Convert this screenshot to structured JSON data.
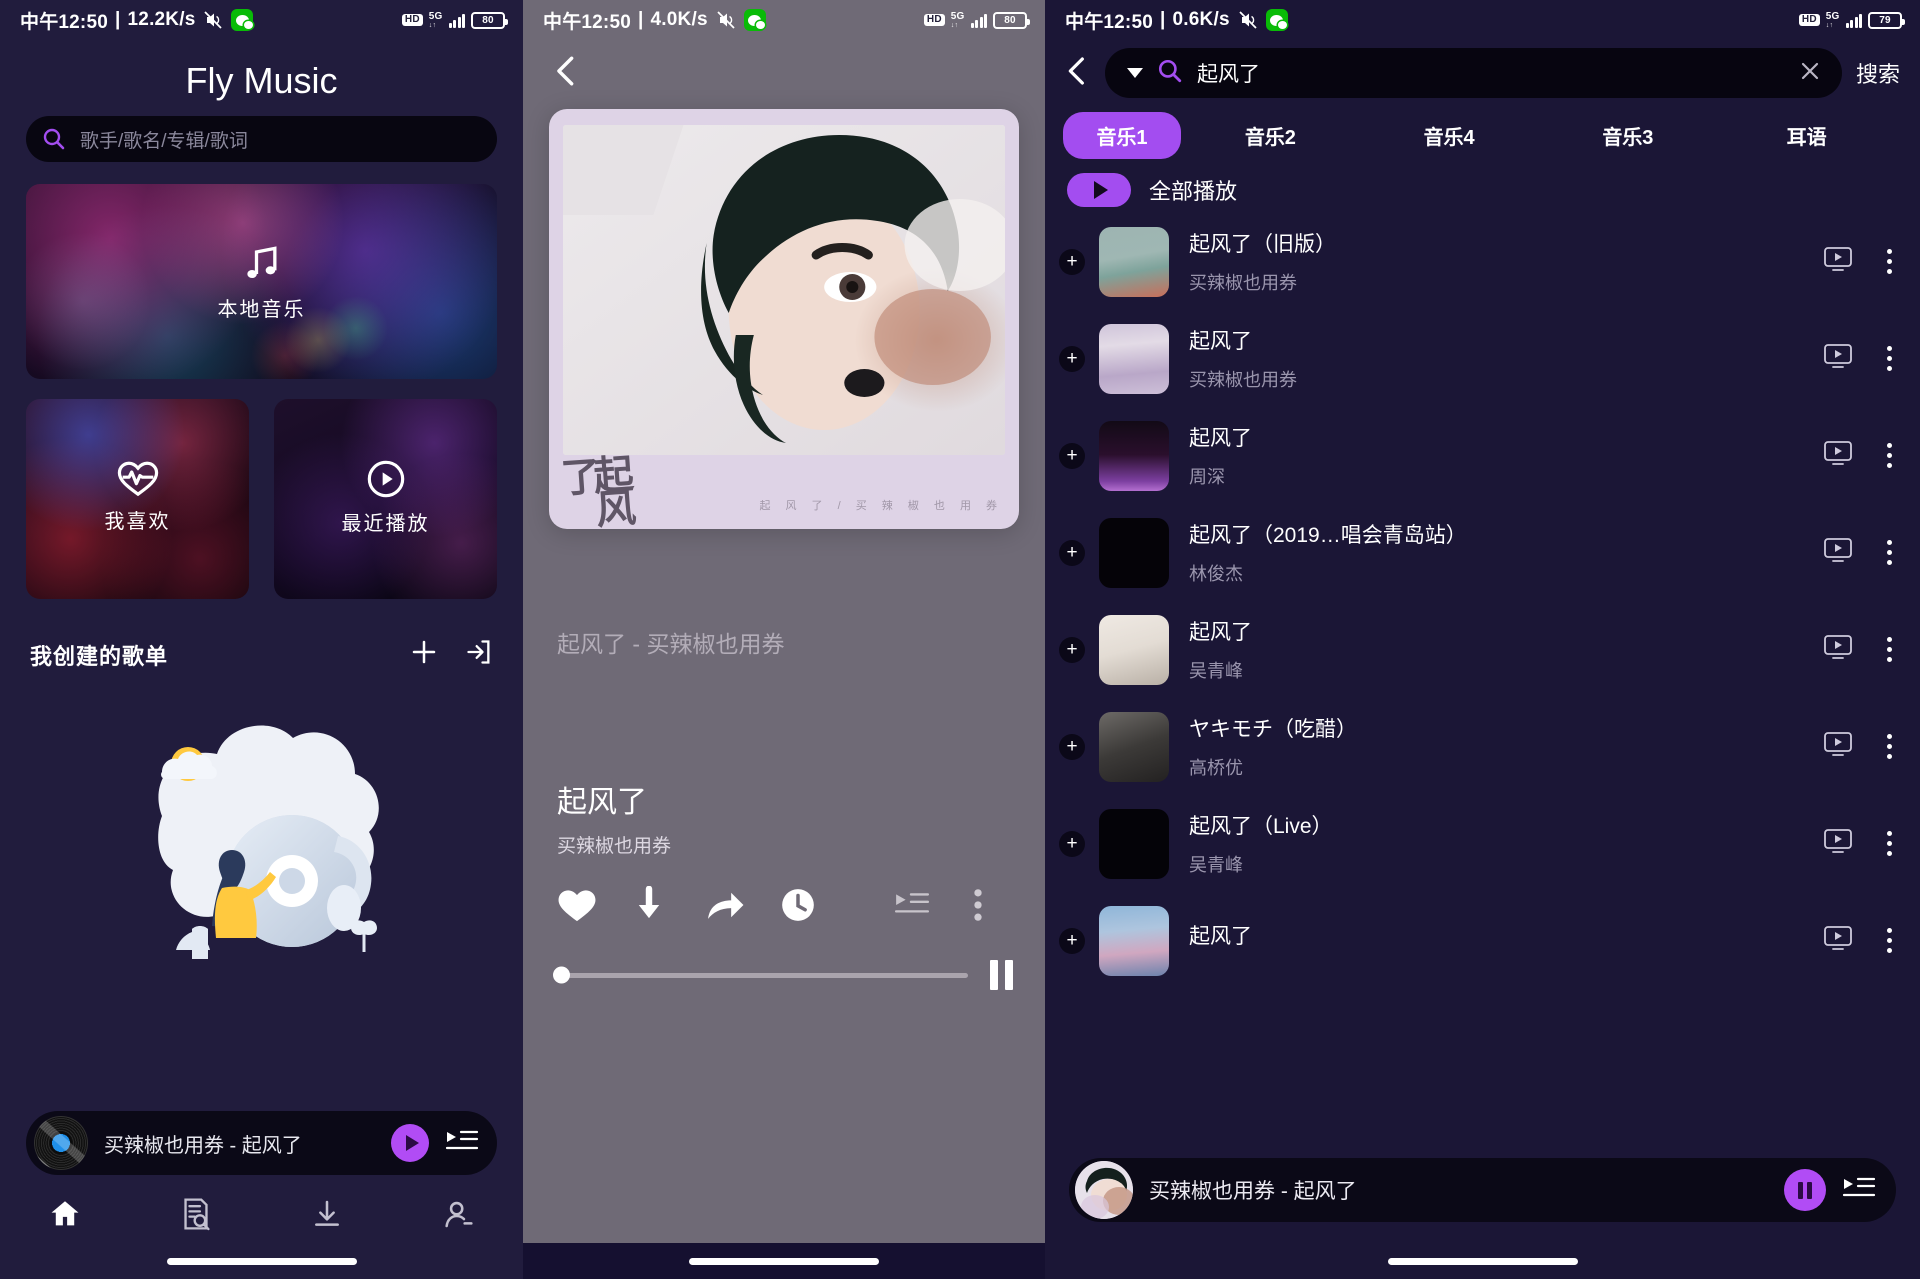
{
  "accent": "#a34df0",
  "status_bars": [
    {
      "time": "中午12:50",
      "speed": "12.2K/s",
      "net": "5G",
      "battery": "80",
      "hd": "HD"
    },
    {
      "time": "中午12:50",
      "speed": "4.0K/s",
      "net": "5G",
      "battery": "80",
      "hd": "HD"
    },
    {
      "time": "中午12:50",
      "speed": "0.6K/s",
      "net": "5G",
      "battery": "79",
      "hd": "HD"
    }
  ],
  "home": {
    "app_title": "Fly Music",
    "search_placeholder": "歌手/歌名/专辑/歌词",
    "cards": {
      "local": "本地音乐",
      "favorite": "我喜欢",
      "recent": "最近播放"
    },
    "section_title": "我创建的歌单",
    "mini_player": {
      "title": "买辣椒也用券 - 起风了"
    }
  },
  "player": {
    "marquee": "起风了 - 买辣椒也用券",
    "title": "起风了",
    "artist": "买辣椒也用券",
    "album_caption": "起 风 了 / 买 辣 椒 也 用 券",
    "album_hanzi": "起风了",
    "progress": 0
  },
  "search": {
    "query": "起风了",
    "submit_label": "搜索",
    "tabs": [
      {
        "label": "音乐1",
        "active": true
      },
      {
        "label": "音乐2",
        "active": false
      },
      {
        "label": "音乐4",
        "active": false
      },
      {
        "label": "音乐3",
        "active": false
      },
      {
        "label": "耳语",
        "active": false
      }
    ],
    "play_all_label": "全部播放",
    "results": [
      {
        "name": "起风了（旧版）",
        "artist": "买辣椒也用券",
        "art": "art-a"
      },
      {
        "name": "起风了",
        "artist": "买辣椒也用券",
        "art": "art-b"
      },
      {
        "name": "起风了",
        "artist": "周深",
        "art": "art-c"
      },
      {
        "name": "起风了（2019…唱会青岛站）",
        "artist": "林俊杰",
        "art": "art-d"
      },
      {
        "name": "起风了",
        "artist": "吴青峰",
        "art": "art-e"
      },
      {
        "name": "ヤキモチ（吃醋）",
        "artist": "高桥优",
        "art": "art-f"
      },
      {
        "name": "起风了（Live）",
        "artist": "吴青峰",
        "art": "art-g"
      },
      {
        "name": "起风了",
        "artist": "",
        "art": "art-h"
      }
    ],
    "mini_player": {
      "title": "买辣椒也用券 - 起风了"
    }
  }
}
